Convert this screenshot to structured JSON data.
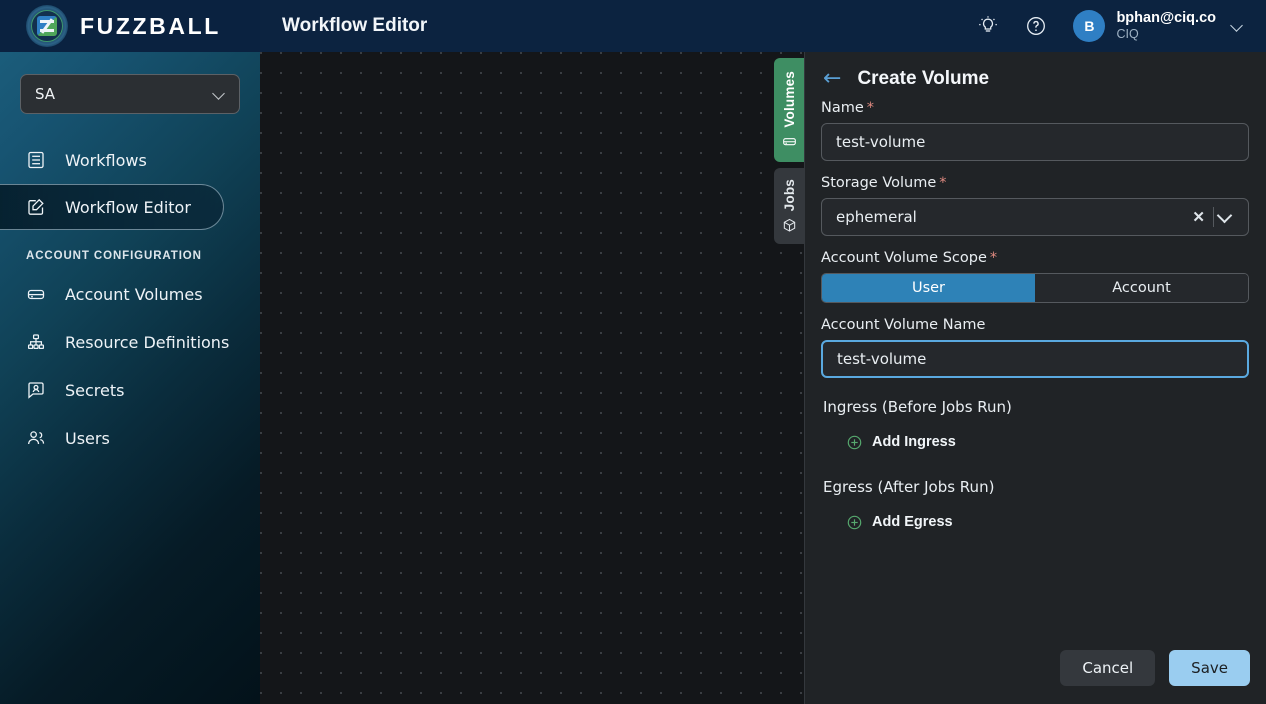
{
  "brand": {
    "name": "FUZZBALL",
    "logo_icon": "fuzzball-logo-icon"
  },
  "header": {
    "title": "Workflow Editor",
    "theme_icon": "lightbulb-icon",
    "help_icon": "question-circle-icon",
    "user": {
      "initial": "B",
      "email": "bphan@ciq.co",
      "org": "CIQ",
      "chevron_icon": "chevron-down-icon"
    }
  },
  "sidebar": {
    "account_selector": {
      "value": "SA",
      "chevron_icon": "chevron-down-icon"
    },
    "items": [
      {
        "label": "Workflows",
        "icon": "list-document-icon",
        "active": false
      },
      {
        "label": "Workflow Editor",
        "icon": "pencil-square-icon",
        "active": true
      }
    ],
    "section_label": "ACCOUNT CONFIGURATION",
    "config_items": [
      {
        "label": "Account Volumes",
        "icon": "drive-icon"
      },
      {
        "label": "Resource Definitions",
        "icon": "sitemap-icon"
      },
      {
        "label": "Secrets",
        "icon": "secret-badge-icon"
      },
      {
        "label": "Users",
        "icon": "users-icon"
      }
    ]
  },
  "tab_rail": [
    {
      "label": "Volumes",
      "icon": "drive-icon",
      "active": true
    },
    {
      "label": "Jobs",
      "icon": "cube-icon",
      "active": false
    }
  ],
  "panel": {
    "back_icon": "arrow-left-icon",
    "title": "Create Volume",
    "fields": {
      "name": {
        "label": "Name",
        "required": true,
        "value": "test-volume",
        "placeholder": ""
      },
      "storage_volume": {
        "label": "Storage Volume",
        "required": true,
        "value": "ephemeral",
        "clear_icon": "close-x-icon",
        "chevron_icon": "chevron-down-icon"
      },
      "scope": {
        "label": "Account Volume Scope",
        "required": true,
        "options": [
          "User",
          "Account"
        ],
        "selected": "User"
      },
      "account_volume_name": {
        "label": "Account Volume Name",
        "required": false,
        "value": "test-volume",
        "focused": true,
        "placeholder": ""
      }
    },
    "ingress": {
      "title": "Ingress (Before Jobs Run)",
      "add_label": "Add Ingress",
      "add_icon": "plus-circle-icon"
    },
    "egress": {
      "title": "Egress (After Jobs Run)",
      "add_label": "Add Egress",
      "add_icon": "plus-circle-icon"
    },
    "actions": {
      "cancel": "Cancel",
      "save": "Save"
    }
  },
  "colors": {
    "accent_blue": "#2e82b7",
    "save_blue": "#9acdf0",
    "focus_blue": "#5aa9e0",
    "tab_green": "#3e8e63",
    "required_red": "#e08a80",
    "header_navy": "#0c2340",
    "panel_bg": "#202326",
    "canvas_bg": "#141619"
  }
}
